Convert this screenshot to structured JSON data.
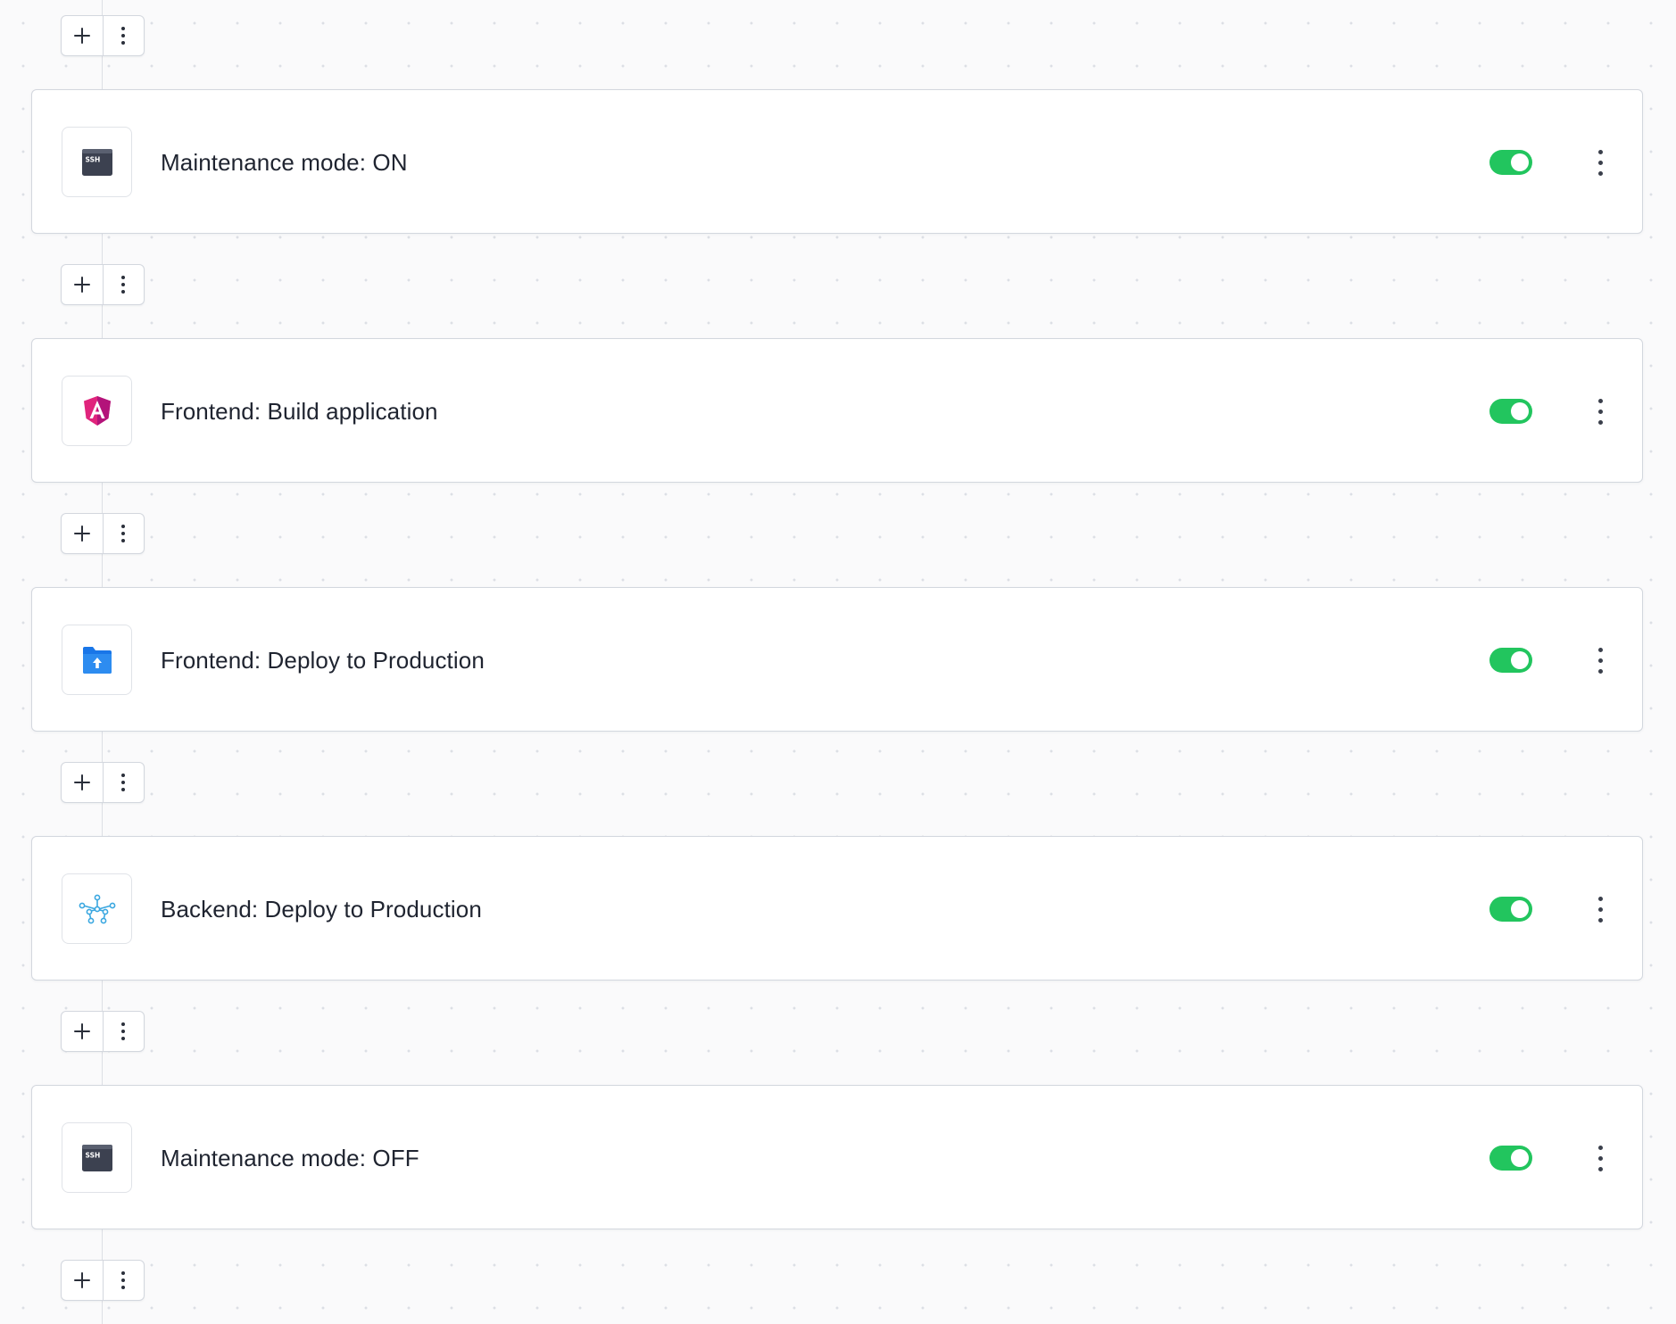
{
  "pipeline": {
    "actions": [
      {
        "title": "Maintenance mode: ON",
        "icon": "ssh-terminal-icon",
        "icon_text": "SSH",
        "enabled": true
      },
      {
        "title": "Frontend: Build application",
        "icon": "angular-icon",
        "enabled": true
      },
      {
        "title": "Frontend: Deploy to Production",
        "icon": "folder-upload-icon",
        "enabled": true
      },
      {
        "title": "Backend: Deploy to Production",
        "icon": "network-nodes-icon",
        "enabled": true
      },
      {
        "title": "Maintenance mode: OFF",
        "icon": "ssh-terminal-icon",
        "icon_text": "SSH",
        "enabled": true
      }
    ]
  },
  "colors": {
    "toggle_on": "#22c55e",
    "angular_pink": "#e0247c",
    "folder_blue": "#1976e8",
    "network_cyan": "#3aa7e0",
    "terminal_dark": "#3c4150"
  }
}
